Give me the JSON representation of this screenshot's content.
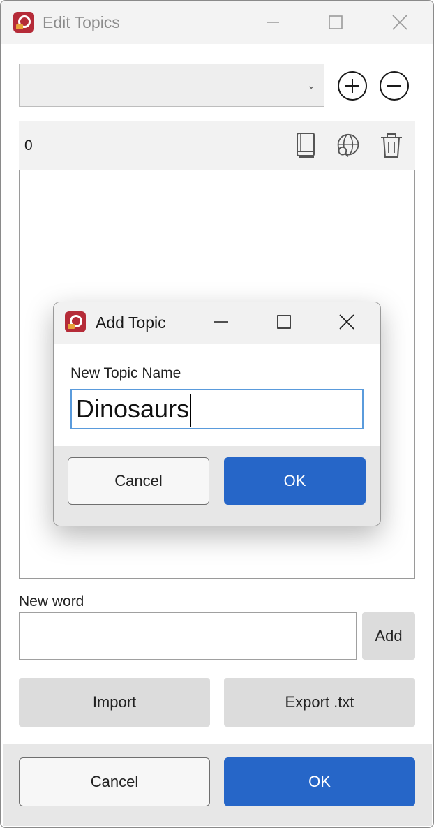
{
  "window": {
    "title": "Edit Topics"
  },
  "topic_select": {
    "selected": ""
  },
  "list": {
    "count": "0",
    "items": []
  },
  "new_word": {
    "label": "New word",
    "value": "",
    "add_label": "Add"
  },
  "actions": {
    "import_label": "Import",
    "export_label": "Export .txt"
  },
  "footer": {
    "cancel_label": "Cancel",
    "ok_label": "OK"
  },
  "dialog": {
    "title": "Add Topic",
    "field_label": "New Topic Name",
    "field_value": "Dinosaurs",
    "cancel_label": "Cancel",
    "ok_label": "OK"
  },
  "colors": {
    "primary": "#2666c8",
    "app_icon": "#b52b38"
  }
}
